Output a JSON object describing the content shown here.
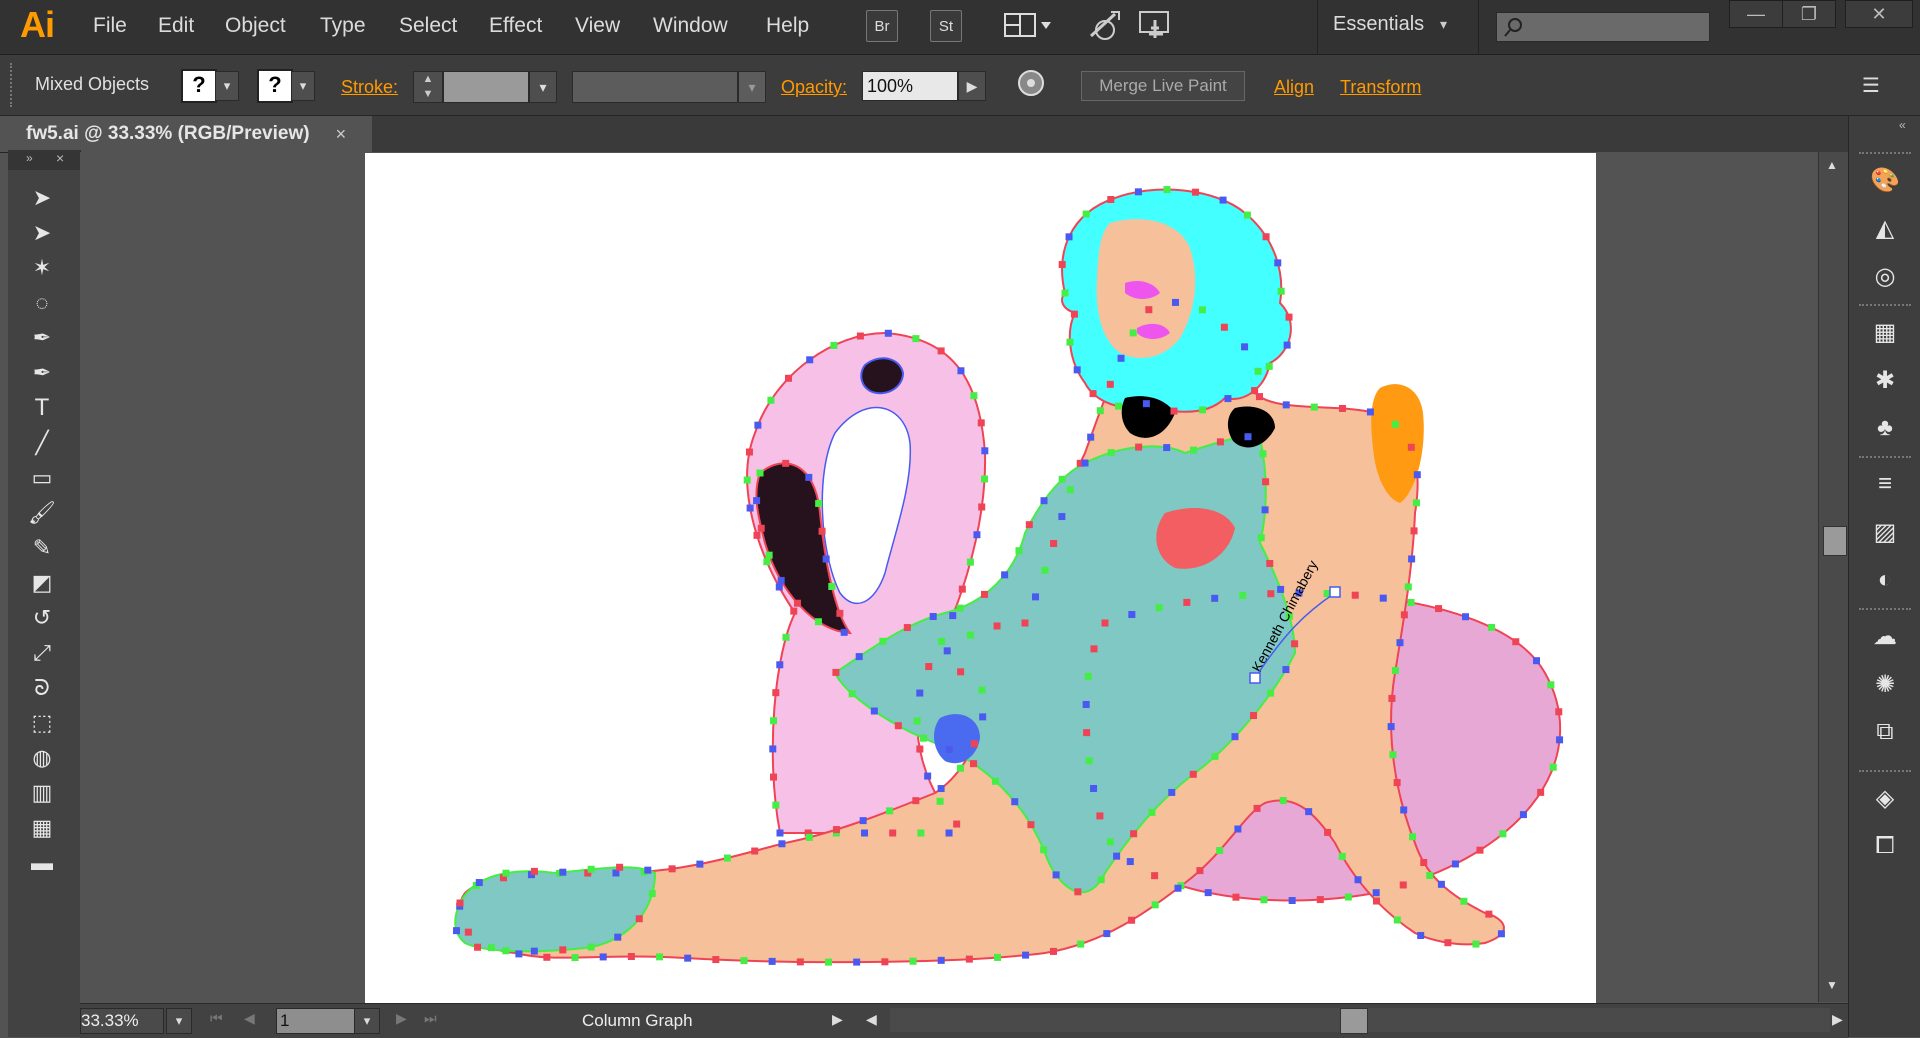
{
  "app": {
    "logo": "Ai",
    "accent": "#ff9a00"
  },
  "menu": {
    "items": [
      "File",
      "Edit",
      "Object",
      "Type",
      "Select",
      "Effect",
      "View",
      "Window",
      "Help"
    ],
    "bridge_label": "Br",
    "stock_label": "St",
    "workspace": "Essentials",
    "search_placeholder": ""
  },
  "control": {
    "selection_label": "Mixed Objects",
    "fill_value": "?",
    "stroke_swatch_value": "?",
    "stroke_label": "Stroke:",
    "opacity_label": "Opacity:",
    "opacity_value": "100%",
    "merge_button": "Merge Live Paint",
    "align_link": "Align",
    "transform_link": "Transform"
  },
  "document": {
    "tab_title": "fw5.ai @ 33.33% (RGB/Preview)",
    "close_glyph": "×"
  },
  "toolbar": {
    "tools": [
      "selection-tool",
      "direct-selection-tool",
      "magic-wand-tool",
      "lasso-tool",
      "pen-tool",
      "curvature-tool",
      "type-tool",
      "line-tool",
      "rectangle-tool",
      "paintbrush-tool",
      "pencil-tool",
      "eraser-tool",
      "rotate-tool",
      "scale-tool",
      "warp-tool",
      "free-transform-tool",
      "shape-builder-tool",
      "column-graph-tool",
      "mesh-tool",
      "gradient-tool"
    ]
  },
  "right_panels": [
    "color-icon",
    "color-guide-icon",
    "appearance-icon",
    "swatches-icon",
    "brushes-icon",
    "symbols-icon",
    "stroke-icon",
    "gradient-icon",
    "transparency-icon",
    "cc-libraries-icon",
    "graphic-styles-icon",
    "artboards-icon",
    "layers-icon",
    "links-icon"
  ],
  "artwork": {
    "signature": "Kenneth Chimabery"
  },
  "status": {
    "zoom": "33.33%",
    "artboard_number": "1",
    "tool_name": "Column Graph",
    "hscroll_position": 0.5,
    "vscroll_position": 0.45
  },
  "colors": {
    "skin": "#f5c09a",
    "hair": "#44ffff",
    "dress": "#7fc8c4",
    "flamingo": "#f7c0e6",
    "float_shadow": "#e8a8d5",
    "neck_dark": "#25121c",
    "anchor_red": "#ee4455",
    "anchor_blue": "#4a5af0",
    "anchor_green": "#44ee44",
    "orange_tattoo": "#ff9a12"
  }
}
